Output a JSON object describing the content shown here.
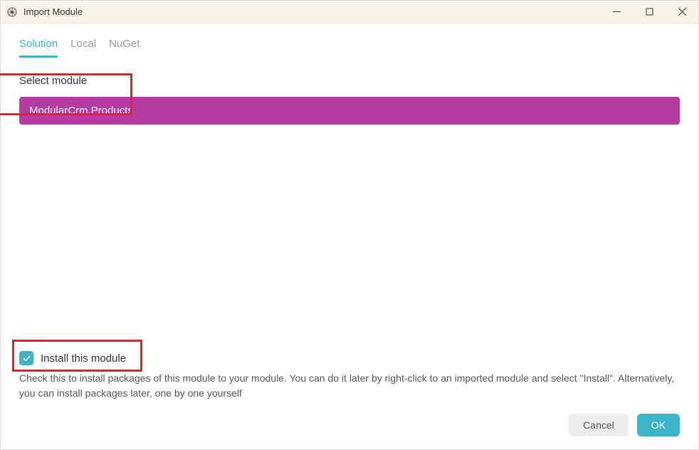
{
  "window": {
    "title": "Import Module"
  },
  "tabs": {
    "solution": "Solution",
    "local": "Local",
    "nuget": "NuGet"
  },
  "section": {
    "label": "Select module"
  },
  "modules": {
    "item0": "ModularCrm.Products"
  },
  "install": {
    "label": "Install this module",
    "help": "Check this to install packages of this module to your module. You can do it later by right-click to an imported module and select \"Install\". Alternatively, you can install packages later, one by one yourself"
  },
  "buttons": {
    "cancel": "Cancel",
    "ok": "OK"
  }
}
